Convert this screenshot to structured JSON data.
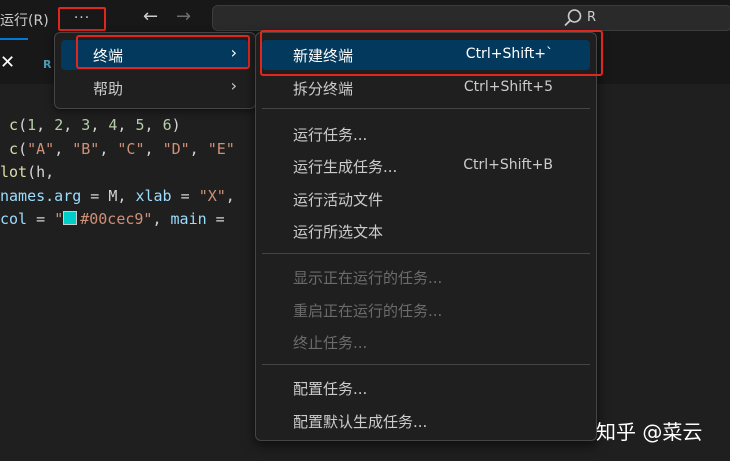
{
  "titlebar": {
    "run_menu": "运行(R)",
    "more_button": "···",
    "search_text": "R"
  },
  "tabs": {
    "close_glyph": "✕",
    "file_icon_glyph": "R"
  },
  "code_lines": {
    "line1": {
      "fn": "c",
      "open": "(",
      "n1": "1",
      "n2": "2",
      "n3": "3",
      "n4": "4",
      "n5": "5",
      "n6": "6",
      "close": ")"
    },
    "line2": {
      "fn": "c",
      "open": "(",
      "s1": "\"A\"",
      "s2": "\"B\"",
      "s3": "\"C\"",
      "s4": "\"D\"",
      "s5": "\"E\""
    },
    "line3": {
      "fn": "lot",
      "rest": "(h,"
    },
    "line4": {
      "arg1": "names.arg",
      "eq": " = M, ",
      "arg2": "xlab",
      "eq2": " = ",
      "s1": "\"X\"",
      "tail": ","
    },
    "line5": {
      "arg1": "col",
      "eq": " = ",
      "color_str": "\"#00cec9\"",
      "after": ", ",
      "arg2": "main",
      "eq2": " = "
    }
  },
  "left_menu": {
    "items": [
      {
        "label": "终端",
        "chevron": "›"
      },
      {
        "label": "帮助",
        "chevron": "›"
      }
    ]
  },
  "terminal_menu": {
    "items": [
      {
        "label": "新建终端",
        "shortcut": "Ctrl+Shift+`"
      },
      {
        "label": "拆分终端",
        "shortcut": "Ctrl+Shift+5"
      },
      {
        "label": "运行任务...",
        "shortcut": ""
      },
      {
        "label": "运行生成任务...",
        "shortcut": "Ctrl+Shift+B"
      },
      {
        "label": "运行活动文件",
        "shortcut": ""
      },
      {
        "label": "运行所选文本",
        "shortcut": ""
      },
      {
        "label": "显示正在运行的任务...",
        "shortcut": ""
      },
      {
        "label": "重启正在运行的任务...",
        "shortcut": ""
      },
      {
        "label": "终止任务...",
        "shortcut": ""
      },
      {
        "label": "配置任务...",
        "shortcut": ""
      },
      {
        "label": "配置默认生成任务...",
        "shortcut": ""
      }
    ]
  },
  "watermark": "知乎 @菜云",
  "colors": {
    "selection": "#04395e",
    "highlight_box": "#e0271f",
    "swatch": "#00cec9"
  }
}
